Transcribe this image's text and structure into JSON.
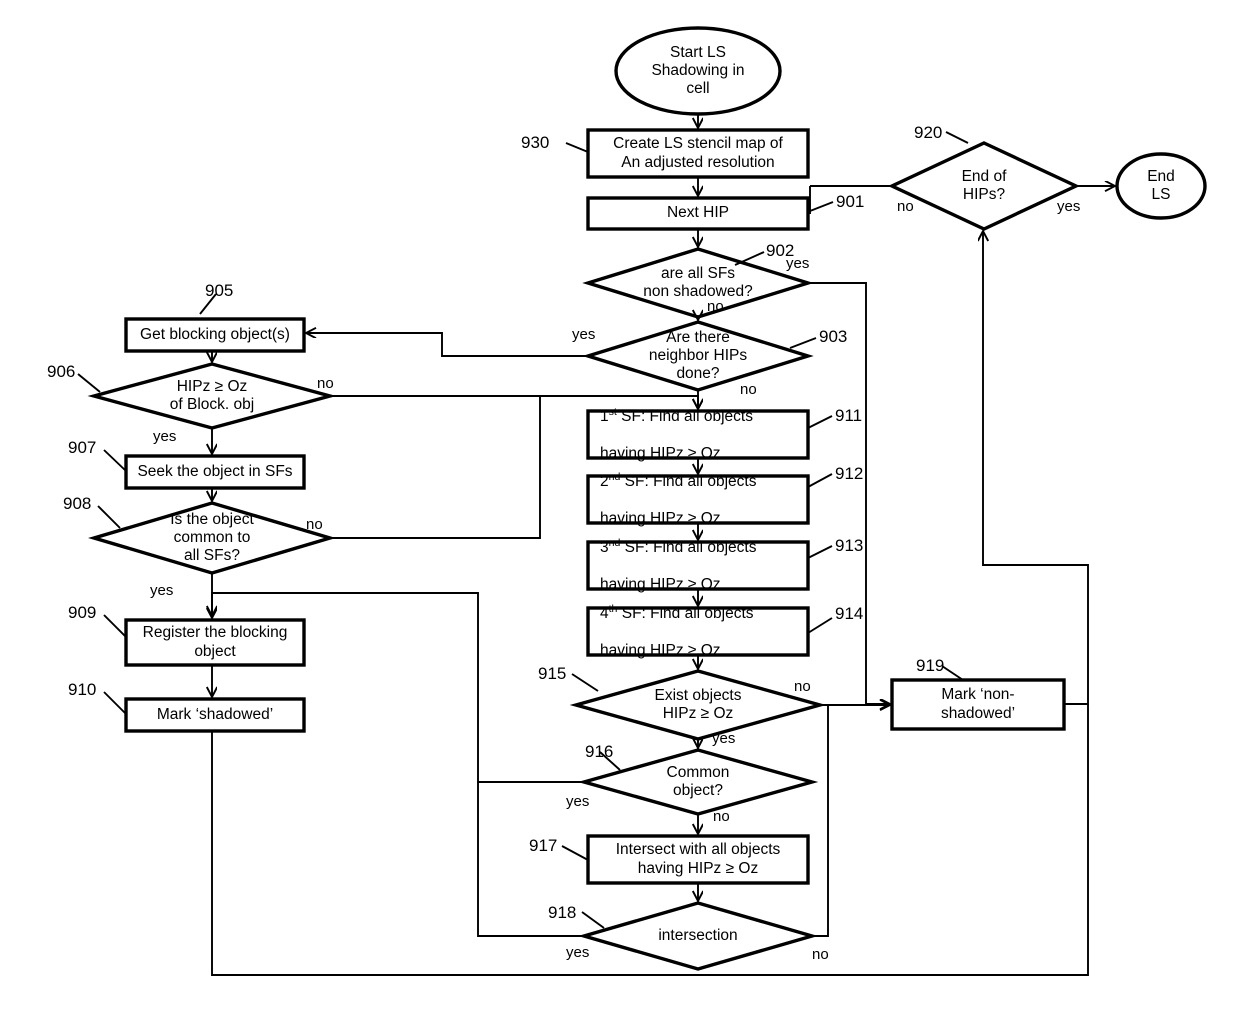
{
  "diagram": {
    "title": "LS Shadowing in cell flowchart",
    "stroke_color": "#000000",
    "fill_color": "#ffffff",
    "background": "#ffffff"
  },
  "nodes": {
    "start": {
      "ref": "",
      "shape": "ellipse",
      "text": "Start LS\nShadowing in\ncell"
    },
    "n930": {
      "ref": "930",
      "shape": "process",
      "text": "Create LS stencil map of\nAn adjusted resolution"
    },
    "n901": {
      "ref": "901",
      "shape": "process",
      "text": "Next HIP"
    },
    "n902": {
      "ref": "902",
      "shape": "decision",
      "text": "are all SFs\nnon shadowed?"
    },
    "n903": {
      "ref": "903",
      "shape": "decision",
      "text": "Are there\nneighbor  HIPs\ndone?"
    },
    "n905": {
      "ref": "905",
      "shape": "process",
      "text": "Get blocking object(s)"
    },
    "n906": {
      "ref": "906",
      "shape": "decision",
      "text": "HIPz ≥ Oz\nof Block. obj"
    },
    "n907": {
      "ref": "907",
      "shape": "process",
      "text": "Seek the object in SFs"
    },
    "n908": {
      "ref": "908",
      "shape": "decision",
      "text": "Is the object\ncommon to\nall SFs?"
    },
    "n909": {
      "ref": "909",
      "shape": "process",
      "text": "Register the blocking\nobject"
    },
    "n910": {
      "ref": "910",
      "shape": "process",
      "text": "Mark ‘shadowed’"
    },
    "n911": {
      "ref": "911",
      "shape": "process",
      "text": "1st SF: Find all objects\nhaving HIPz ≥ Oz",
      "sup_prefix": "1",
      "sup": "st",
      "rest": " SF: Find all objects"
    },
    "n912": {
      "ref": "912",
      "shape": "process",
      "text": "2nd  SF: Find all objects\nhaving HIPz ≥ Oz",
      "sup_prefix": "2",
      "sup": "nd",
      "rest": "  SF: Find all objects"
    },
    "n913": {
      "ref": "913",
      "shape": "process",
      "text": "3nd  SF: Find all objects\nhaving HIPz ≥ Oz",
      "sup_prefix": "3",
      "sup": "nd",
      "rest": "  SF: Find all objects"
    },
    "n914": {
      "ref": "914",
      "shape": "process",
      "text": "4th  SF: Find all objects\nhaving HIPz ≥ Oz",
      "sup_prefix": "4",
      "sup": "th",
      "rest": "  SF: Find all objects"
    },
    "n915": {
      "ref": "915",
      "shape": "decision",
      "text": "Exist objects\nHIPz ≥ Oz"
    },
    "n916": {
      "ref": "916",
      "shape": "decision",
      "text": "Common\nobject?"
    },
    "n917": {
      "ref": "917",
      "shape": "process",
      "text": "Intersect with all objects\nhaving HIPz ≥ Oz"
    },
    "n918": {
      "ref": "918",
      "shape": "decision",
      "text": "intersection"
    },
    "n919": {
      "ref": "919",
      "shape": "process",
      "text": "Mark ‘non-\nshadowed’"
    },
    "n920": {
      "ref": "920",
      "shape": "decision",
      "text": "End of\nHIPs?"
    },
    "end": {
      "ref": "",
      "shape": "ellipse",
      "text": "End\nLS"
    }
  },
  "second_line": {
    "having": "having HIPz ≥ Oz"
  },
  "edge_labels": {
    "e902_yes": "yes",
    "e902_no": "no",
    "e903_yes": "yes",
    "e903_no": "no",
    "e906_no": "no",
    "e906_yes": "yes",
    "e908_no": "no",
    "e908_yes": "yes",
    "e915_no": "no",
    "e915_yes": "yes",
    "e916_yes": "yes",
    "e916_no": "no",
    "e918_yes": "yes",
    "e918_no": "no",
    "e920_no": "no",
    "e920_yes": "yes"
  }
}
